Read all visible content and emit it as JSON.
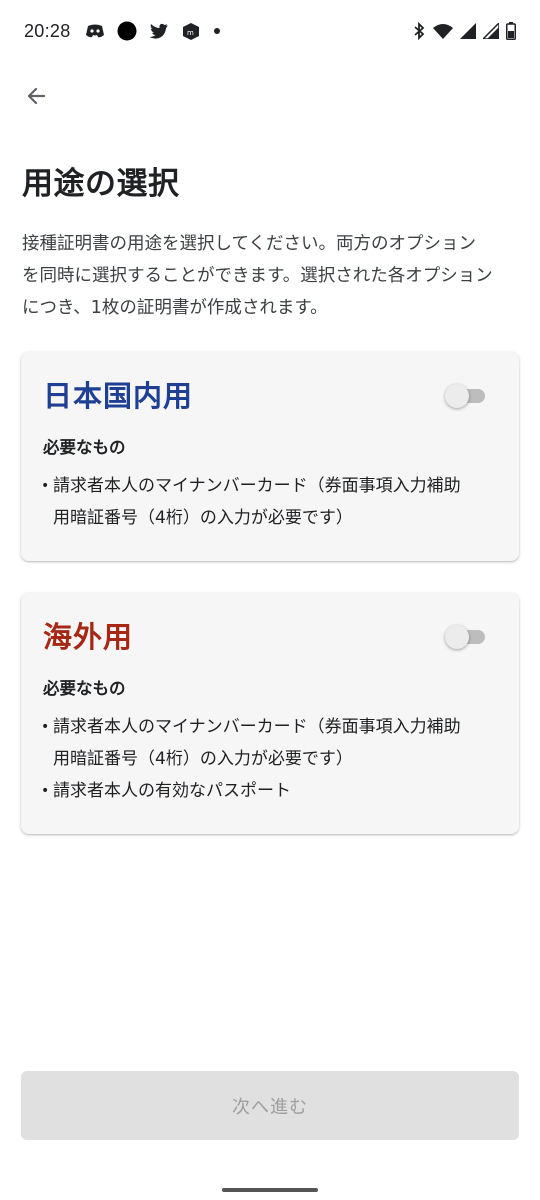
{
  "status_bar": {
    "time": "20:28",
    "left_icons": [
      "discord-icon",
      "circle-app-icon",
      "twitter-icon",
      "app-icon",
      "dot-icon"
    ],
    "right_icons": [
      "bluetooth-icon",
      "wifi-icon",
      "signal-icon",
      "signal-icon",
      "battery-icon"
    ]
  },
  "header": {
    "back_icon": "arrow-back-icon",
    "title": "用途の選択"
  },
  "description": {
    "lines": [
      "接種証明書の用途を選択してください。両方のオプション",
      "を同時に選択することができます。選択された各オプション",
      "につき、1枚の証明書が作成されます。"
    ]
  },
  "options": [
    {
      "title": "日本国内用",
      "title_color": "#1f3f94",
      "toggle_on": false,
      "requirements_heading": "必要なもの",
      "requirements": [
        [
          "請求者本人のマイナンバーカード（券面事項入力補助",
          "用暗証番号（4桁）の入力が必要です）"
        ]
      ]
    },
    {
      "title": "海外用",
      "title_color": "#a52714",
      "toggle_on": false,
      "requirements_heading": "必要なもの",
      "requirements": [
        [
          "請求者本人のマイナンバーカード（券面事項入力補助",
          "用暗証番号（4桁）の入力が必要です）"
        ],
        [
          "請求者本人の有効なパスポート"
        ]
      ]
    }
  ],
  "footer": {
    "next_label": "次へ進む",
    "next_enabled": false
  },
  "colors": {
    "domestic_title": "#1f3f94",
    "overseas_title": "#a52714",
    "card_bg": "#f6f6f6",
    "button_disabled_bg": "#e0e0e0"
  }
}
